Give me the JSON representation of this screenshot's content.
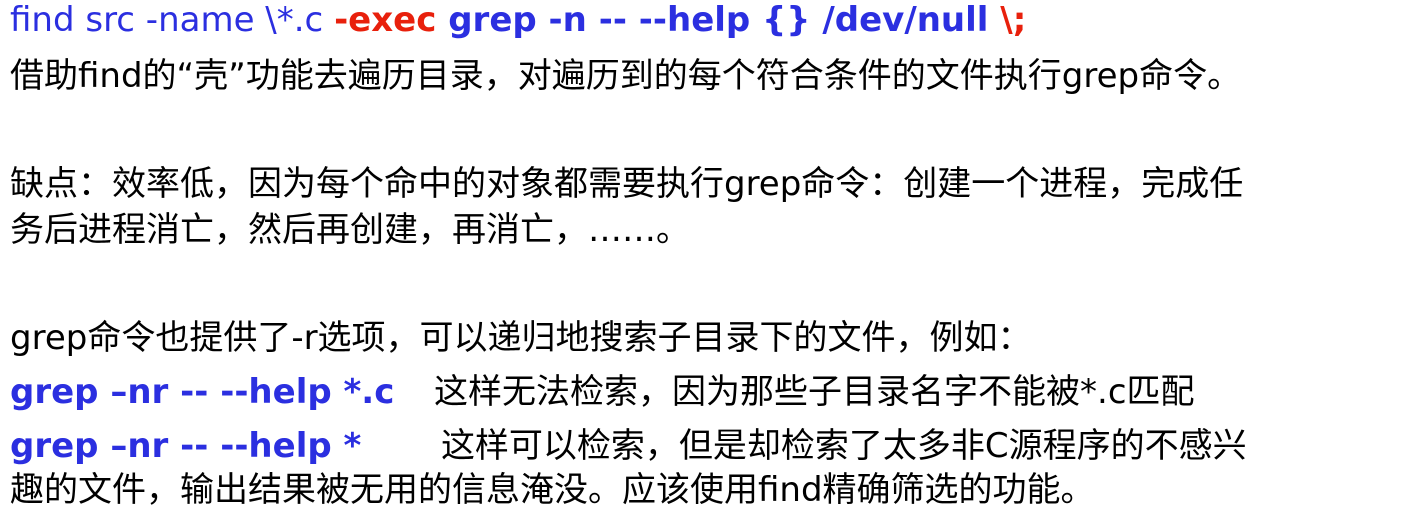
{
  "command_line": {
    "part1": "find src -name \\*.c ",
    "part2": "-exec ",
    "part3": "grep  -n -- --help {} /dev/null ",
    "part4": "\\;"
  },
  "explanation": "借助find的“壳”功能去遍历目录，对遍历到的每个符合条件的文件执行grep命令。",
  "drawback": {
    "line1": "缺点：效率低，因为每个命中的对象都需要执行grep命令：创建一个进程，完成任",
    "line2": "务后进程消亡，然后再创建，再消亡，……。"
  },
  "grep_r": {
    "intro": "grep命令也提供了-r选项，可以递归地搜索子目录下的文件，例如：",
    "example1": {
      "cmd": "grep –nr -- --help *.c",
      "note": "这样无法检索，因为那些子目录名字不能被*.c匹配"
    },
    "example2": {
      "cmd": "grep –nr -- --help *",
      "note_line1": "这样可以检索，但是却检索了太多非C源程序的不感兴",
      "note_line2": "趣的文件，输出结果被无用的信息淹没。应该使用find精确筛选的功能。"
    }
  },
  "colors": {
    "blue": "#2b2fe0",
    "red": "#e8200c",
    "text": "#000000"
  }
}
